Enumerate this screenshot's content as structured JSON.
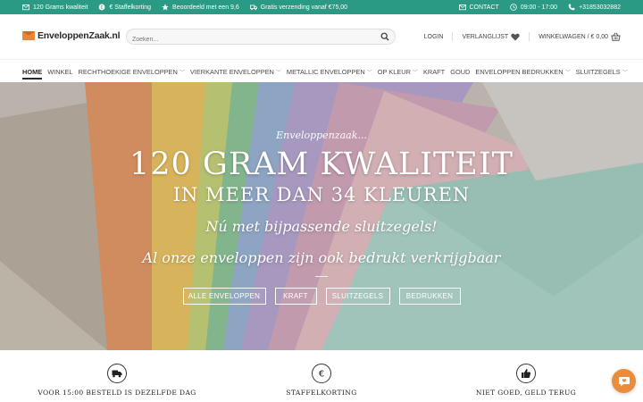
{
  "topbar": {
    "items_left": [
      {
        "icon": "mail-icon",
        "text": "120 Grams kwaliteit"
      },
      {
        "icon": "euro-circle-icon",
        "text": "€ Staffelkorting"
      },
      {
        "icon": "star-icon",
        "text": "Beoordeeld met een 9,6"
      },
      {
        "icon": "truck-icon",
        "text": "Gratis verzending vanaf €75,00"
      }
    ],
    "items_right": [
      {
        "icon": "mail-icon",
        "text": "CONTACT"
      },
      {
        "icon": "clock-icon",
        "text": "09:00 - 17:00"
      },
      {
        "icon": "phone-icon",
        "text": "+31853032882"
      }
    ],
    "color": "#2a9a84"
  },
  "header": {
    "logo_text": "EnveloppenZaak.nl",
    "search_placeholder": "Zoeken...",
    "login": "LOGIN",
    "wishlist": "VERLANGLIJST",
    "cart": "WINKELWAGEN / € 0,00"
  },
  "nav": {
    "items": [
      {
        "label": "HOME",
        "chevron": false,
        "active": true
      },
      {
        "label": "WINKEL",
        "chevron": false
      },
      {
        "label": "RECHTHOEKIGE ENVELOPPEN",
        "chevron": true
      },
      {
        "label": "VIERKANTE ENVELOPPEN",
        "chevron": true
      },
      {
        "label": "METALLIC ENVELOPPEN",
        "chevron": true
      },
      {
        "label": "OP KLEUR",
        "chevron": true
      },
      {
        "label": "KRAFT",
        "chevron": false
      },
      {
        "label": "GOUD",
        "chevron": false
      },
      {
        "label": "ENVELOPPEN BEDRUKKEN",
        "chevron": true
      },
      {
        "label": "SLUITZEGELS",
        "chevron": true
      }
    ]
  },
  "hero": {
    "script": "Enveloppenzaak...",
    "title": "120 GRAM KWALITEIT",
    "subtitle": "IN MEER DAN 34 KLEUREN",
    "line1": "Nú met bijpassende sluitzegels!",
    "line2": "Al onze enveloppen zijn ook bedrukt verkrijgbaar",
    "buttons": [
      "ALLE ENVELOPPEN",
      "KRAFT",
      "SLUITZEGELS",
      "BEDRUKKEN"
    ]
  },
  "features": [
    {
      "icon": "truck-icon",
      "label": "VOOR 15:00 BESTELD IS DEZELFDE DAG"
    },
    {
      "icon": "euro-icon",
      "label": "STAFFELKORTING"
    },
    {
      "icon": "thumbs-up-icon",
      "label": "NIET GOED, GELD TERUG"
    }
  ]
}
